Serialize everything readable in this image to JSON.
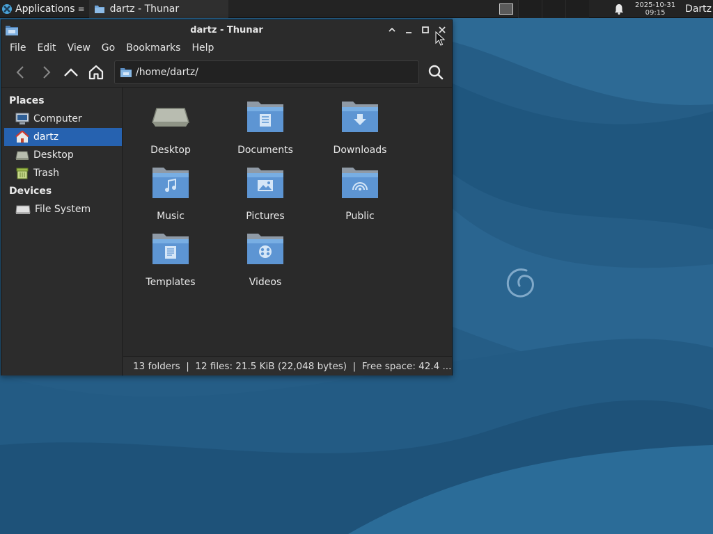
{
  "panel": {
    "applications_label": "Applications",
    "task_label": "dartz - Thunar",
    "clock_date": "2025-10-31",
    "clock_time": "09:15",
    "user_label": "Dartz"
  },
  "window": {
    "title": "dartz - Thunar",
    "menu": [
      "File",
      "Edit",
      "View",
      "Go",
      "Bookmarks",
      "Help"
    ],
    "location": "/home/dartz/"
  },
  "sidebar": {
    "places_header": "Places",
    "places": [
      {
        "label": "Computer",
        "icon": "computer-icon"
      },
      {
        "label": "dartz",
        "icon": "home-folder-icon",
        "active": true
      },
      {
        "label": "Desktop",
        "icon": "desktop-icon"
      },
      {
        "label": "Trash",
        "icon": "trash-icon"
      }
    ],
    "devices_header": "Devices",
    "devices": [
      {
        "label": "File System",
        "icon": "drive-icon"
      }
    ]
  },
  "files": [
    {
      "label": "Desktop",
      "icon": "desktop-folder-icon"
    },
    {
      "label": "Documents",
      "icon": "documents-folder-icon"
    },
    {
      "label": "Downloads",
      "icon": "downloads-folder-icon"
    },
    {
      "label": "Music",
      "icon": "music-folder-icon"
    },
    {
      "label": "Pictures",
      "icon": "pictures-folder-icon"
    },
    {
      "label": "Public",
      "icon": "public-folder-icon"
    },
    {
      "label": "Templates",
      "icon": "templates-folder-icon"
    },
    {
      "label": "Videos",
      "icon": "videos-folder-icon"
    }
  ],
  "status": "13 folders  |  12 files: 21.5 KiB (22,048 bytes)  |  Free space: 42.4 ...",
  "colors": {
    "accent": "#2662b0",
    "panel": "#232323",
    "window": "#2b2b2b",
    "folder": "#5d95d3",
    "wallpaper": "#255d86"
  }
}
